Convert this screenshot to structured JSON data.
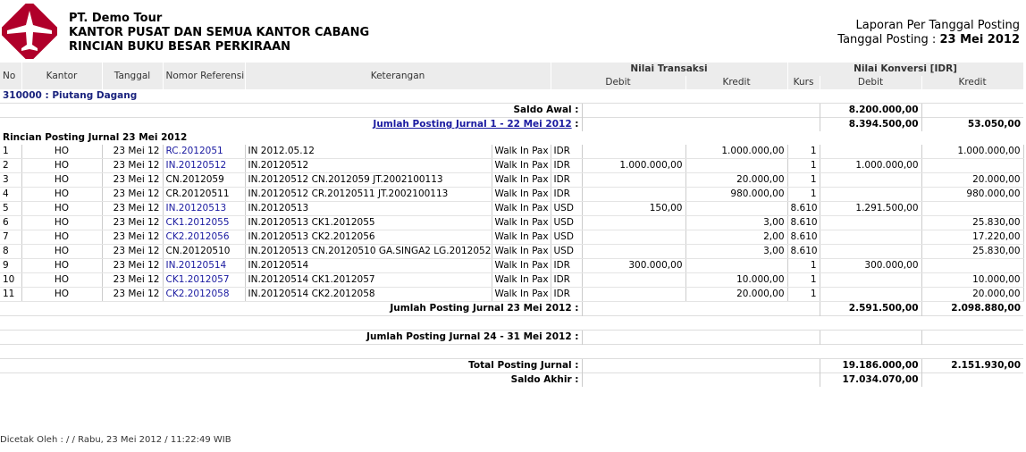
{
  "header": {
    "company": "PT. Demo Tour",
    "line2": "KANTOR PUSAT DAN SEMUA KANTOR CABANG",
    "line3": "RINCIAN BUKU BESAR PERKIRAAN",
    "report_title": "Laporan Per Tanggal Posting",
    "date_label": "Tanggal Posting :",
    "date_value": "23 Mei 2012"
  },
  "columns": {
    "no": "No",
    "kantor": "Kantor",
    "tanggal": "Tanggal",
    "ref": "Nomor Referensi",
    "ket": "Keterangan",
    "nilai_transaksi": "Nilai Transaksi",
    "nilai_konversi": "Nilai Konversi [IDR]",
    "debit": "Debit",
    "kredit": "Kredit",
    "kurs": "Kurs",
    "debit2": "Debit",
    "kredit2": "Kredit"
  },
  "account": "310000 : Piutang Dagang",
  "saldo_awal": {
    "label": "Saldo Awal :",
    "debit": "8.200.000,00",
    "kredit": ""
  },
  "posting_before": {
    "label": "Jumlah Posting Jurnal 1 - 22 Mei 2012",
    "colon": ":",
    "debit": "8.394.500,00",
    "kredit": "53.050,00"
  },
  "detail_title": "Rincian Posting Jurnal 23 Mei 2012",
  "rows": [
    {
      "no": "1",
      "kantor": "HO",
      "tgl": "23 Mei 12",
      "ref": "RC.2012051",
      "link": true,
      "ket": "IN 2012.05.12",
      "ket2": "Walk In Pax",
      "cur": "IDR",
      "tdebit": "",
      "tkredit": "1.000.000,00",
      "kurs": "1",
      "kdebit": "",
      "kkredit": "1.000.000,00"
    },
    {
      "no": "2",
      "kantor": "HO",
      "tgl": "23 Mei 12",
      "ref": "IN.20120512",
      "link": true,
      "ket": "IN.20120512",
      "ket2": "Walk In Pax",
      "cur": "IDR",
      "tdebit": "1.000.000,00",
      "tkredit": "",
      "kurs": "1",
      "kdebit": "1.000.000,00",
      "kkredit": ""
    },
    {
      "no": "3",
      "kantor": "HO",
      "tgl": "23 Mei 12",
      "ref": "CN.2012059",
      "link": false,
      "ket": "IN.20120512 CN.2012059 JT.2002100113",
      "ket2": "Walk In Pax",
      "cur": "IDR",
      "tdebit": "",
      "tkredit": "20.000,00",
      "kurs": "1",
      "kdebit": "",
      "kkredit": "20.000,00"
    },
    {
      "no": "4",
      "kantor": "HO",
      "tgl": "23 Mei 12",
      "ref": "CR.20120511",
      "link": false,
      "ket": "IN.20120512 CR.20120511 JT.2002100113",
      "ket2": "Walk In Pax",
      "cur": "IDR",
      "tdebit": "",
      "tkredit": "980.000,00",
      "kurs": "1",
      "kdebit": "",
      "kkredit": "980.000,00"
    },
    {
      "no": "5",
      "kantor": "HO",
      "tgl": "23 Mei 12",
      "ref": "IN.20120513",
      "link": true,
      "ket": "IN.20120513",
      "ket2": "Walk In Pax",
      "cur": "USD",
      "tdebit": "150,00",
      "tkredit": "",
      "kurs": "8.610",
      "kdebit": "1.291.500,00",
      "kkredit": ""
    },
    {
      "no": "6",
      "kantor": "HO",
      "tgl": "23 Mei 12",
      "ref": "CK1.2012055",
      "link": true,
      "ket": "IN.20120513 CK1.2012055",
      "ket2": "Walk In Pax",
      "cur": "USD",
      "tdebit": "",
      "tkredit": "3,00",
      "kurs": "8.610",
      "kdebit": "",
      "kkredit": "25.830,00"
    },
    {
      "no": "7",
      "kantor": "HO",
      "tgl": "23 Mei 12",
      "ref": "CK2.2012056",
      "link": true,
      "ket": "IN.20120513 CK2.2012056",
      "ket2": "Walk In Pax",
      "cur": "USD",
      "tdebit": "",
      "tkredit": "2,00",
      "kurs": "8.610",
      "kdebit": "",
      "kkredit": "17.220,00"
    },
    {
      "no": "8",
      "kantor": "HO",
      "tgl": "23 Mei 12",
      "ref": "CN.20120510",
      "link": false,
      "ket": "IN.20120513 CN.20120510 GA.SINGA2 LG.2012052",
      "ket2": "Walk In Pax",
      "cur": "USD",
      "tdebit": "",
      "tkredit": "3,00",
      "kurs": "8.610",
      "kdebit": "",
      "kkredit": "25.830,00"
    },
    {
      "no": "9",
      "kantor": "HO",
      "tgl": "23 Mei 12",
      "ref": "IN.20120514",
      "link": true,
      "ket": "IN.20120514",
      "ket2": "Walk In Pax",
      "cur": "IDR",
      "tdebit": "300.000,00",
      "tkredit": "",
      "kurs": "1",
      "kdebit": "300.000,00",
      "kkredit": ""
    },
    {
      "no": "10",
      "kantor": "HO",
      "tgl": "23 Mei 12",
      "ref": "CK1.2012057",
      "link": true,
      "ket": "IN.20120514 CK1.2012057",
      "ket2": "Walk In Pax",
      "cur": "IDR",
      "tdebit": "",
      "tkredit": "10.000,00",
      "kurs": "1",
      "kdebit": "",
      "kkredit": "10.000,00"
    },
    {
      "no": "11",
      "kantor": "HO",
      "tgl": "23 Mei 12",
      "ref": "CK2.2012058",
      "link": true,
      "ket": "IN.20120514 CK2.2012058",
      "ket2": "Walk In Pax",
      "cur": "IDR",
      "tdebit": "",
      "tkredit": "20.000,00",
      "kurs": "1",
      "kdebit": "",
      "kkredit": "20.000,00"
    }
  ],
  "posting_today": {
    "label": "Jumlah Posting Jurnal 23 Mei 2012 :",
    "debit": "2.591.500,00",
    "kredit": "2.098.880,00"
  },
  "posting_after": {
    "label": "Jumlah Posting Jurnal 24 - 31 Mei 2012 :",
    "debit": "",
    "kredit": ""
  },
  "total": {
    "label": "Total Posting Jurnal :",
    "debit": "19.186.000,00",
    "kredit": "2.151.930,00"
  },
  "saldo_akhir": {
    "label": "Saldo Akhir :",
    "debit": "17.034.070,00",
    "kredit": ""
  },
  "footer": "Dicetak Oleh : / / Rabu, 23 Mei 2012 / 11:22:49 WIB",
  "colors": {
    "accent": "#b0002a",
    "header_bg": "#ececec",
    "link": "#1a1aa0",
    "account": "#1a237e"
  }
}
